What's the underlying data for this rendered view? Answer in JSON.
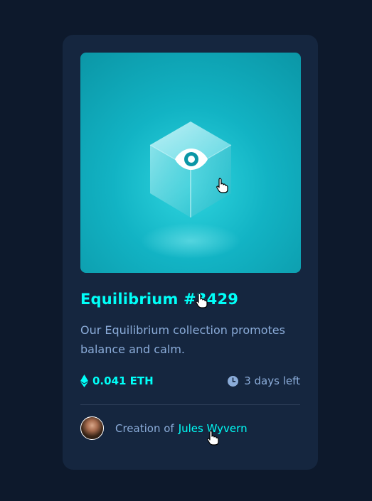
{
  "card": {
    "title": "Equilibrium #3429",
    "description": "Our Equilibrium collection promotes balance and calm.",
    "price": "0.041 ETH",
    "time_left": "3 days left",
    "creator_prefix": "Creation of",
    "creator_name": "Jules Wyvern"
  },
  "colors": {
    "page_bg": "#0d192c",
    "card_bg": "#15263f",
    "accent_cyan": "#00fff8",
    "soft_blue": "#8bacd9",
    "divider": "#2e405a"
  },
  "icons": [
    "view-eye-icon",
    "ethereum-icon",
    "clock-icon",
    "hand-cursor-icon"
  ]
}
